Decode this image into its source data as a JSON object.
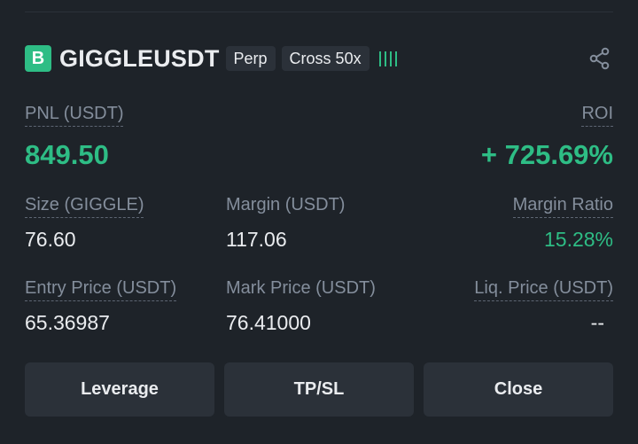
{
  "position": {
    "side_badge": "B",
    "symbol": "GIGGLEUSDT",
    "tags": [
      "Perp",
      "Cross 50x"
    ],
    "signal_icon": "bar-signal-icon",
    "share_icon": "share-icon"
  },
  "pnl": {
    "label": "PNL (USDT)",
    "value": "849.50"
  },
  "roi": {
    "label": "ROI",
    "value": "+ 725.69%"
  },
  "stats": {
    "size": {
      "label": "Size (GIGGLE)",
      "value": "76.60"
    },
    "margin": {
      "label": "Margin (USDT)",
      "value": "117.06"
    },
    "margin_ratio": {
      "label": "Margin Ratio",
      "value": "15.28%"
    },
    "entry_price": {
      "label": "Entry Price (USDT)",
      "value": "65.36987"
    },
    "mark_price": {
      "label": "Mark Price (USDT)",
      "value": "76.41000"
    },
    "liq_price": {
      "label": "Liq. Price (USDT)",
      "value": "--"
    }
  },
  "actions": {
    "leverage": "Leverage",
    "tpsl": "TP/SL",
    "close": "Close"
  },
  "colors": {
    "background": "#1e2329",
    "positive": "#2ebd85",
    "muted_text": "#848e9c",
    "button_bg": "#2b3139"
  }
}
